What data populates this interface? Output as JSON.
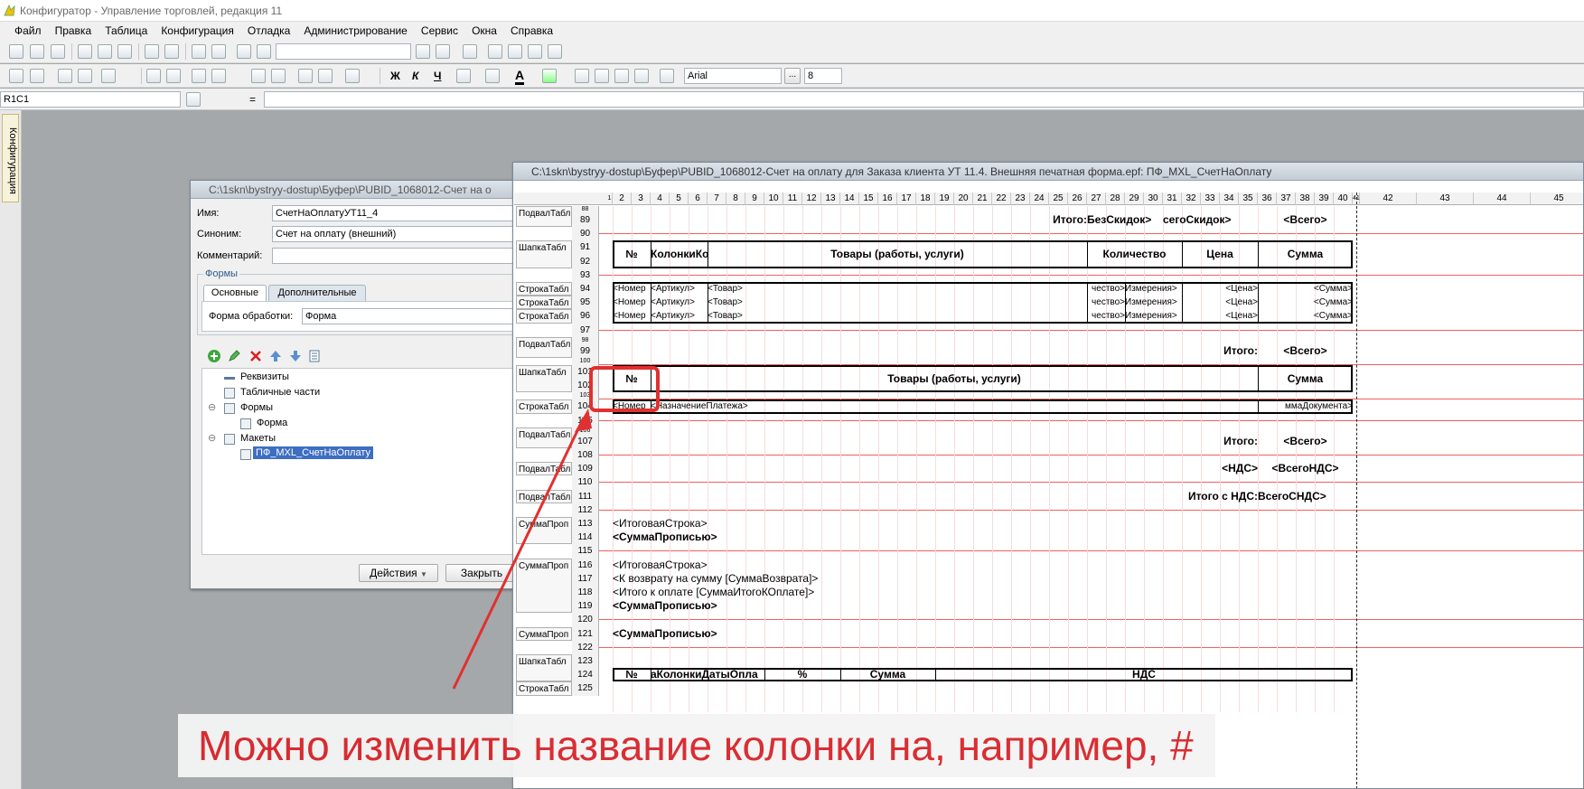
{
  "app": {
    "title": "Конфигуратор - Управление торговлей, редакция 11"
  },
  "menu": [
    "Файл",
    "Правка",
    "Таблица",
    "Конфигурация",
    "Отладка",
    "Администрирование",
    "Сервис",
    "Окна",
    "Справка"
  ],
  "toolbar": {
    "font_name": "Arial",
    "font_size": "8",
    "ellipsis": "..."
  },
  "address": {
    "cell_ref": "R1C1",
    "equals": "="
  },
  "left_dock": {
    "tab": "Конфигурация"
  },
  "props_window": {
    "title": "C:\\1skn\\bystryy-dostup\\Буфер\\PUBID_1068012-Счет на о",
    "name_label": "Имя:",
    "name_value": "СчетНаОплатуУТ11_4",
    "synonym_label": "Синоним:",
    "synonym_value": "Счет на оплату (внешний)",
    "comment_label": "Комментарий:",
    "comment_value": "",
    "forms_group": "Формы",
    "tab_basic": "Основные",
    "tab_extra": "Дополнительные",
    "form_label": "Форма обработки:",
    "form_value": "Форма",
    "tree": [
      "Реквизиты",
      "Табличные части",
      "Формы",
      "Форма",
      "Макеты",
      "ПФ_MXL_СчетНаОплату"
    ],
    "actions_button": "Действия",
    "close_button": "Закрыть"
  },
  "sheet_window": {
    "title": "C:\\1skn\\bystryy-dostup\\Буфер\\PUBID_1068012-Счет на оплату для Заказа клиента УТ 11.4. Внешняя печатная форма.epf: ПФ_MXL_СчетНаОплату",
    "columns": [
      "1",
      "2",
      "3",
      "4",
      "5",
      "6",
      "7",
      "8",
      "9",
      "10",
      "11",
      "12",
      "13",
      "14",
      "15",
      "16",
      "17",
      "18",
      "19",
      "20",
      "21",
      "22",
      "23",
      "24",
      "25",
      "26",
      "27",
      "28",
      "29",
      "30",
      "31",
      "32",
      "33",
      "34",
      "35",
      "36",
      "37",
      "38",
      "39",
      "40",
      "41",
      "42",
      "43",
      "44",
      "45"
    ],
    "rows": [
      "88",
      "89",
      "90",
      "91",
      "92",
      "93",
      "94",
      "95",
      "96",
      "97",
      "98",
      "99",
      "100",
      "101",
      "102",
      "103",
      "104",
      "105",
      "106",
      "107",
      "108",
      "109",
      "110",
      "111",
      "112",
      "113",
      "114",
      "115",
      "116",
      "117",
      "118",
      "119",
      "120",
      "121",
      "122",
      "123",
      "124",
      "125"
    ],
    "groups": [
      "ПодвалТабл",
      "ШапкаТабл",
      "СтрокаТабл",
      "СтрокаТабл",
      "СтрокаТабл",
      "ПодвалТабл",
      "ШапкаТабл",
      "СтрокаТабл",
      "ПодвалТабл",
      "ПодвалТабл",
      "ПодвалТабл",
      "СуммаПроп",
      "СуммаПроп",
      "СуммаПроп",
      "ШапкаТабл",
      "СтрокаТабл"
    ],
    "cells": {
      "r89_itogo": "Итого:",
      "r89_bez": "БезСкидок>",
      "r89_vsego_skidok": "сегоСкидок>",
      "r89_vsego": "<Всего>",
      "h1_no": "№",
      "h1_kol": "КолонкиКо",
      "h1_tovary": "Товары (работы, услуги)",
      "h1_kolichestvo": "Количество",
      "h1_cena": "Цена",
      "h1_summa": "Сумма",
      "row_nomer": "<Номер",
      "row_artikul": "<Артикул>",
      "row_tovar": "<Товар>",
      "row_kol": "чество>",
      "row_izm": "Измерения>",
      "row_cena": "<Цена>",
      "row_summa": "<Сумма>",
      "r99_itogo": "Итого:",
      "r99_vsego": "<Всего>",
      "h2_no": "№",
      "h2_tovary": "Товары (работы, услуги)",
      "h2_summa": "Сумма",
      "r104_nomer": "<Номер",
      "r104_naznach": "<НазначениеПлатежа>",
      "r104_summa": "ммаДокумента>",
      "r107_itogo": "Итого:",
      "r107_vsego": "<Всего>",
      "r109_nds": "<НДС>",
      "r109_vsego_nds": "<ВсегоНДС>",
      "r111_text": "Итого с НДС:",
      "r111_val": "ВсегоСНДС>",
      "r113": "<ИтоговаяСтрока>",
      "r114": "<СуммаПрописью>",
      "r116": "<ИтоговаяСтрока>",
      "r117": "<К возврату на сумму [СуммаВозврата]>",
      "r118": "<Итого к оплате [СуммаИтогоКОплате]>",
      "r119": "<СуммаПрописью>",
      "r121": "<СуммаПрописью>",
      "h3_no": "№",
      "h3_kol": "аКолонкиДатыОпла",
      "h3_pct": "%",
      "h3_summa": "Сумма",
      "h3_nds": "НДС"
    }
  },
  "annotation": {
    "text": "Можно изменить название колонки на, например, #",
    "color": "#d8262b"
  }
}
